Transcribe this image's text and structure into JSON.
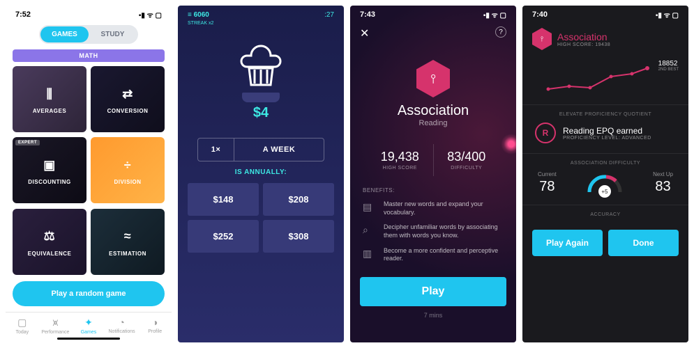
{
  "s1": {
    "time": "7:52",
    "status": "▪▮ ᯤ ▢",
    "tabs": {
      "games": "GAMES",
      "study": "STUDY"
    },
    "category": "MATH",
    "tiles": [
      {
        "label": "AVERAGES"
      },
      {
        "label": "CONVERSION"
      },
      {
        "label": "DISCOUNTING",
        "badge": "EXPERT"
      },
      {
        "label": "DIVISION"
      },
      {
        "label": "EQUIVALENCE"
      },
      {
        "label": "ESTIMATION"
      }
    ],
    "play": "Play a random game",
    "nav": [
      {
        "label": "Today"
      },
      {
        "label": "Performance"
      },
      {
        "label": "Games"
      },
      {
        "label": "Notifications"
      },
      {
        "label": "Profile"
      }
    ]
  },
  "s2": {
    "score_icon": "≡",
    "score": "6060",
    "streak": "STREAK x2",
    "timer": ":27",
    "price": "$4",
    "mult": "1×",
    "period": "A WEEK",
    "prompt": "IS ANNUALLY:",
    "answers": [
      "$148",
      "$208",
      "$252",
      "$308"
    ]
  },
  "s3": {
    "time": "7:43",
    "title": "Association",
    "subtitle": "Reading",
    "stats": [
      {
        "value": "19,438",
        "label": "HIGH SCORE"
      },
      {
        "value": "83/400",
        "label": "DIFFICULTY"
      }
    ],
    "benefits_label": "BENEFITS:",
    "benefits": [
      "Master new words and expand your vocabulary.",
      "Decipher unfamiliar words by associating them with words you know.",
      "Become a more confident and perceptive reader."
    ],
    "play": "Play",
    "time_est": "7 mins"
  },
  "s4": {
    "time": "7:40",
    "title": "Association",
    "high_score": "HIGH SCORE: 19438",
    "best_val": "18852",
    "best_lbl": "2ND BEST",
    "sec1": "ELEVATE PROFICIENCY QUOTIENT",
    "epq_letter": "R",
    "epq_title": "Reading EPQ earned",
    "epq_sub": "PROFICIENCY LEVEL: ADVANCED",
    "sec2": "ASSOCIATION DIFFICULTY",
    "current_lbl": "Current",
    "current_val": "78",
    "plus": "+5",
    "next_lbl": "Next Up",
    "next_val": "83",
    "sec3": "ACCURACY",
    "play_again": "Play Again",
    "done": "Done"
  }
}
